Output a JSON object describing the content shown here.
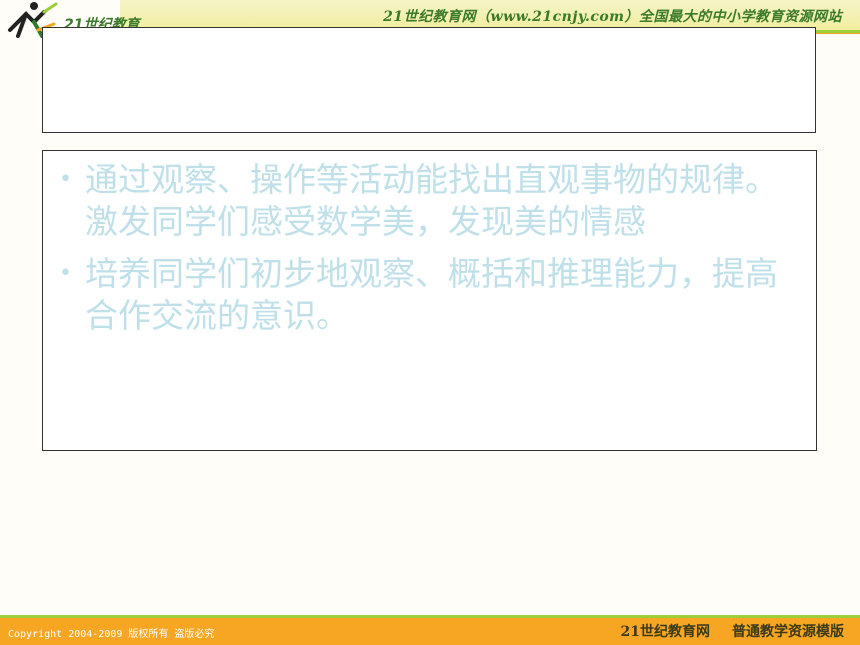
{
  "header": {
    "logo_text": "21世纪教育",
    "tagline": "21世纪教育网（www.21cnjy.com）全国最大的中小学教育资源网站"
  },
  "title_box": {
    "title": ""
  },
  "content": {
    "bullets": [
      "通过观察、操作等活动能找出直观事物的规律。激发同学们感受数学美，发现美的情感",
      "培养同学们初步地观察、概括和推理能力，提高合作交流的意识。"
    ]
  },
  "footer": {
    "copyright": "Copyright 2004-2009 版权所有 盗版必究",
    "site_name": "21世纪教育网",
    "template_name": "普通教学资源模版"
  },
  "colors": {
    "accent_orange": "#f6a623",
    "accent_green": "#9bcf3a",
    "bullet_text": "#bfe0e8"
  }
}
